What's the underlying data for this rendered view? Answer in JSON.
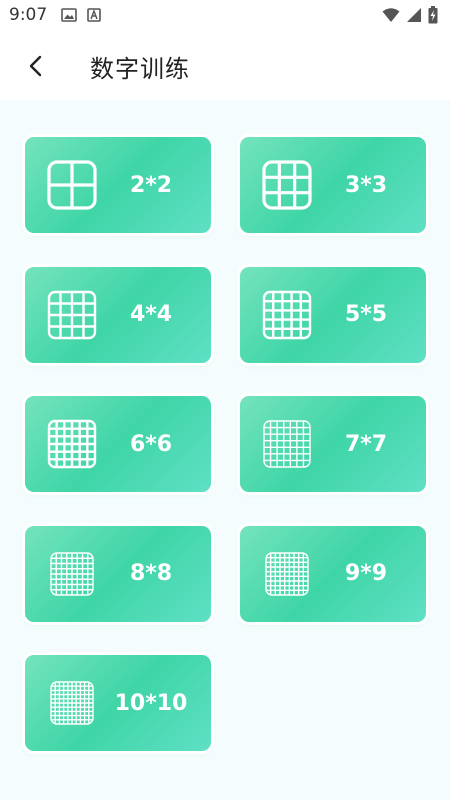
{
  "status_bar": {
    "time": "9:07",
    "left_icons": [
      "image-icon",
      "text-recognition-icon"
    ],
    "right_icons": [
      "wifi-icon",
      "signal-icon",
      "battery-icon"
    ]
  },
  "header": {
    "title": "数字训练",
    "back_icon": "chevron-left-icon"
  },
  "grid_options": [
    {
      "label": "2*2",
      "n": 2
    },
    {
      "label": "3*3",
      "n": 3
    },
    {
      "label": "4*4",
      "n": 4
    },
    {
      "label": "5*5",
      "n": 5
    },
    {
      "label": "6*6",
      "n": 6
    },
    {
      "label": "7*7",
      "n": 7
    },
    {
      "label": "8*8",
      "n": 8
    },
    {
      "label": "9*9",
      "n": 9
    },
    {
      "label": "10*10",
      "n": 10
    }
  ],
  "colors": {
    "card_gradient": [
      "#74e3bd",
      "#3fd5a7",
      "#5fe0c4"
    ],
    "content_background": "#f4fcfd",
    "text_on_card": "#ffffff"
  }
}
